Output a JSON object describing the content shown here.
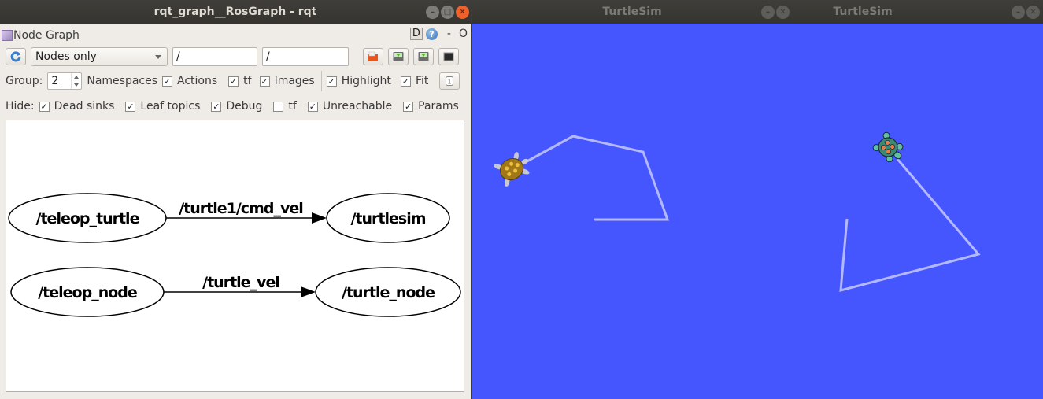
{
  "rqt_window": {
    "title": "rqt_graph__RosGraph - rqt",
    "plugin_title": "Node Graph",
    "d_button": "D",
    "help_button": "?",
    "minus_label": "-",
    "o_label": "O",
    "toolbar": {
      "graph_type": "Nodes only",
      "node_filter": "/",
      "topic_filter": "/"
    },
    "options": {
      "group_label": "Group:",
      "group_value": "2",
      "namespaces_label": "Namespaces",
      "items": [
        {
          "label": "Actions",
          "checked": true
        },
        {
          "label": "tf",
          "checked": true
        },
        {
          "label": "Images",
          "checked": true
        },
        {
          "label": "Highlight",
          "checked": true
        },
        {
          "label": "Fit",
          "checked": true
        }
      ]
    },
    "hide": {
      "label": "Hide:",
      "items": [
        {
          "label": "Dead sinks",
          "checked": true
        },
        {
          "label": "Leaf topics",
          "checked": true
        },
        {
          "label": "Debug",
          "checked": true
        },
        {
          "label": "tf",
          "checked": false
        },
        {
          "label": "Unreachable",
          "checked": true
        },
        {
          "label": "Params",
          "checked": true
        }
      ]
    },
    "graph": {
      "nodes": [
        "/teleop_turtle",
        "/turtlesim",
        "/teleop_node",
        "/turtle_node"
      ],
      "edges": [
        {
          "from": "/teleop_turtle",
          "to": "/turtlesim",
          "topic": "/turtle1/cmd_vel"
        },
        {
          "from": "/teleop_node",
          "to": "/turtle_node",
          "topic": "/turtle_vel"
        }
      ]
    }
  },
  "turtlesim_windows": [
    {
      "title": "TurtleSim",
      "background": "#4556ff",
      "pen_color": "#b3b8ff"
    },
    {
      "title": "TurtleSim",
      "background": "#4556ff",
      "pen_color": "#b3b8ff"
    }
  ]
}
